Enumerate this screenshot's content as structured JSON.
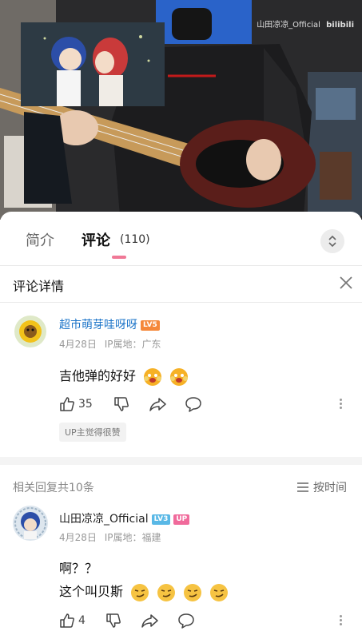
{
  "video": {
    "watermark_user": "山田凉凉_Official",
    "watermark_brand": "bilibili"
  },
  "tabs": [
    {
      "label": "简介",
      "active": false
    },
    {
      "label": "评论",
      "active": true,
      "count": "(110)"
    }
  ],
  "detail": {
    "title": "评论详情"
  },
  "root_comment": {
    "username": "超市萌芽哇呀呀",
    "level": "LV5",
    "date": "4月28日",
    "ip": "IP属地：广东",
    "text": "吉他弹的好好",
    "likes": "35",
    "up_liked": "UP主觉得很赞"
  },
  "replies_header": {
    "count_text": "相关回复共10条",
    "sort_label": "按时间"
  },
  "reply": {
    "username": "山田凉凉_Official",
    "level": "LV3",
    "up_badge": "UP",
    "date": "4月28日",
    "ip": "IP属地：福建",
    "line1": "啊？？",
    "line2": "这个叫贝斯",
    "likes": "4"
  },
  "colors": {
    "accent_pink": "#f07896",
    "username_blue": "#1a73c8",
    "level5_orange": "#f5883a",
    "level3_cyan": "#59b8e6",
    "up_badge_pink": "#f06a9b"
  }
}
